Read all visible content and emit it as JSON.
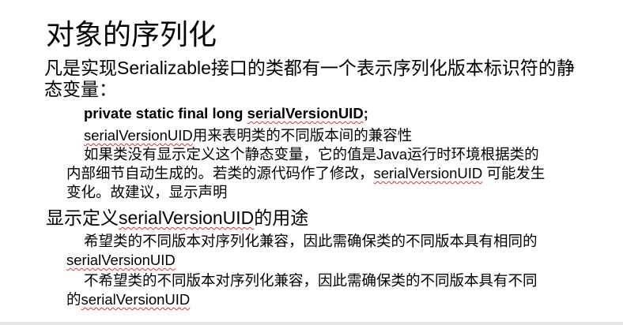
{
  "slide": {
    "title": "对象的序列化",
    "intro_line1": "凡是实现Serializable接口的类都有一个表示序列化版本标识符的静",
    "intro_line2": "态变量：",
    "code_prefix": "private static final long ",
    "code_uid": "serialVersionUID",
    "code_suffix": ";",
    "purpose_uid": "serialVersionUID",
    "purpose_rest": "用来表明类的不同版本间的兼容性",
    "default_line1": "如果类没有显示定义这个静态变量，它的值是Java运行时环境根据类的",
    "default_line2_pre": "内部细节自动生成的。若类的源代码作了修改，",
    "default_line2_uid": "serialVersionUID",
    "default_line2_post": " 可能发生",
    "default_line3": "变化。故建议，显示声明",
    "heading2_pre": "显示定义",
    "heading2_uid": "serialVersionUID",
    "heading2_post": "的用途",
    "compat_line1": "希望类的不同版本对序列化兼容，因此需确保类的不同版本具有相同的",
    "compat_line2_uid": "serialVersionUID",
    "incompat_line1": "不希望类的不同版本对序列化兼容，因此需确保类的不同版本具有不同",
    "incompat_line2_pre": "的",
    "incompat_line2_uid": "serialVersionUID"
  }
}
